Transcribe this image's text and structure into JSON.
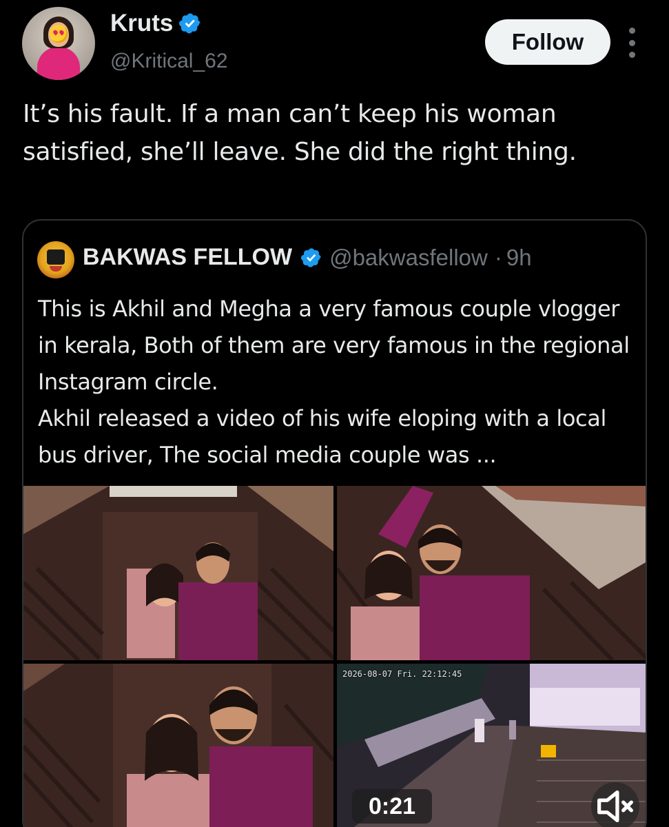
{
  "author": {
    "display_name": "Kruts",
    "handle": "@Kritical_62",
    "verified": true,
    "avatar_icon": "profile-photo-with-heart-eyes-emoji"
  },
  "actions": {
    "follow_label": "Follow",
    "more_icon": "vertical-dots-icon"
  },
  "tweet": {
    "text": "It’s his fault. If a man can’t keep his woman satisfied, she’ll leave. She did the right thing."
  },
  "quoted_tweet": {
    "display_name": "BAKWAS FELLOW",
    "handle": "@bakwasfellow",
    "separator": "·",
    "time": "9h",
    "verified": true,
    "text": "This is Akhil and Megha a very famous couple vlogger in kerala, Both of them are very famous in the regional Instagram circle.\nAkhil released a video of his wife eloping with a local bus driver, The social media couple was ...",
    "media": {
      "cctv_timestamp": "2026-08-07 Fri. 22:12:45",
      "video_duration": "0:21",
      "mute_icon": "speaker-muted-icon"
    }
  },
  "colors": {
    "background": "#000000",
    "text_primary": "#e7e9ea",
    "text_secondary": "#71767b",
    "verified_blue": "#1d9bf0",
    "border": "#2f3336",
    "follow_bg": "#eff3f4"
  }
}
